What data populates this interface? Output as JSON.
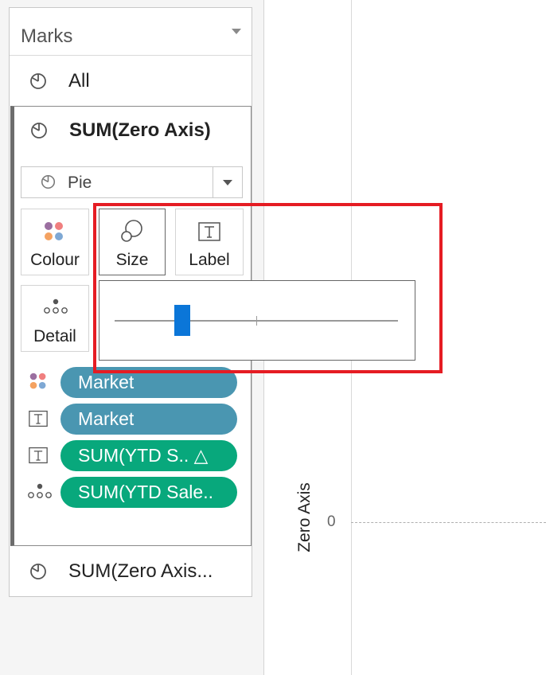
{
  "marks_card": {
    "title": "Marks",
    "all_label": "All",
    "selected_label": "SUM(Zero Axis)",
    "mark_type": "Pie",
    "buttons": {
      "colour": "Colour",
      "size": "Size",
      "label": "Label",
      "detail": "Detail"
    },
    "size_slider": {
      "value_fraction": 0.24
    },
    "pills": [
      {
        "icon": "colour-icon",
        "text": "Market",
        "color": "#4a96b1"
      },
      {
        "icon": "label-icon",
        "text": "Market",
        "color": "#4a96b1"
      },
      {
        "icon": "label-icon",
        "text": "SUM(YTD S.. △",
        "color": "#08a87c"
      },
      {
        "icon": "detail-icon",
        "text": "SUM(YTD Sale..",
        "color": "#08a87c"
      }
    ],
    "second_mark_label": "SUM(Zero Axis..."
  },
  "view": {
    "axis_title": "Zero Axis",
    "zero_tick": "0"
  },
  "highlight_color": "#e51c23"
}
